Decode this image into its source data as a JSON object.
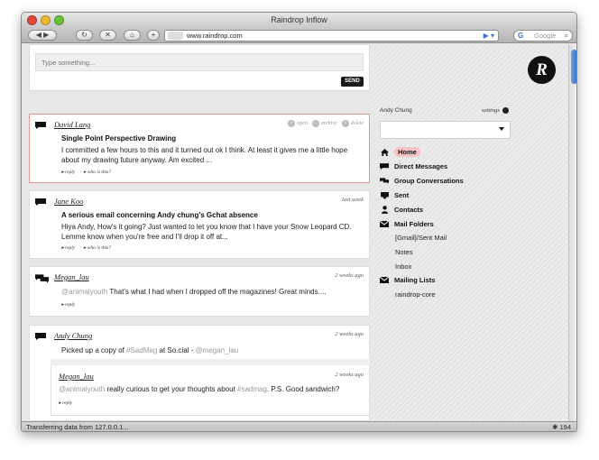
{
  "window": {
    "title": "Raindrop Inflow"
  },
  "toolbar": {
    "url": "www.raindrop.com",
    "search_placeholder": "Google"
  },
  "status": {
    "text": "Transferring data from 127.0.0.1...",
    "count": "194"
  },
  "compose": {
    "placeholder": "Type something...",
    "send_label": "SEND"
  },
  "messages": [
    {
      "author": "David Lang",
      "subject": "Single Point Perspective Drawing",
      "body_line1": "I committed a few hours to this and it turned out ok I think. At least it gives me a little hope",
      "body_line2": "about my drawing future anyway. Am excited ...",
      "links": [
        "▸ reply",
        "▸ who is this?"
      ],
      "actions": [
        "open",
        "archive",
        "delete"
      ]
    },
    {
      "author": "Jane Koo",
      "time": "last week",
      "subject": "A serious email concerning Andy chung's Gchat absence",
      "body_line1": "Hiya Andy, How's it going? Just wanted to let you know that I have your Snow Leopard CD.",
      "body_line2": "Lemme know when you're free and I'll drop it off at...",
      "links": [
        "▸ reply",
        "▸ who is this?"
      ]
    },
    {
      "author": "Megan_lau",
      "time": "2 weeks ago",
      "handle": "@animalyouth",
      "body_rest": " That's what I had when I dropped off the magazines! Great minds....",
      "links": [
        "▸ reply"
      ]
    },
    {
      "author": "Andy Chung",
      "time": "2 weeks ago",
      "body_pre": "Picked up a copy of ",
      "hashtag": "#SadMag",
      "body_mid": " at So.cial - ",
      "handle": "@megan_lau",
      "reply": {
        "author": "Megan_lau",
        "time": "2 weeks ago",
        "handle": "@animalyouth",
        "body_mid": " really curious to get your thoughts about ",
        "hashtag": "#sadmag",
        "body_end": ". P.S. Good sandwich?",
        "link": "▸ reply"
      }
    }
  ],
  "sidebar": {
    "account_name": "Andy Chung",
    "settings_label": "settings",
    "nav": [
      {
        "label": "Home",
        "icon": "home-icon"
      },
      {
        "label": "Direct Messages",
        "icon": "direct-messages-icon"
      },
      {
        "label": "Group Conversations",
        "icon": "group-conversations-icon"
      },
      {
        "label": "Sent",
        "icon": "sent-icon"
      },
      {
        "label": "Contacts",
        "icon": "contacts-icon"
      },
      {
        "label": "Mail Folders",
        "icon": "mail-folders-icon"
      }
    ],
    "mail_folders": [
      "[Gmail]/Sent Mail",
      "Notes",
      "Inbox"
    ],
    "mailing_lists_label": "Mailing Lists",
    "mailing_lists": [
      "raindrop-core"
    ]
  },
  "colors": {
    "selected_border": "#e49a93",
    "home_highlight": "#f8c3c0",
    "handle_gray": "#9a9a9a"
  }
}
